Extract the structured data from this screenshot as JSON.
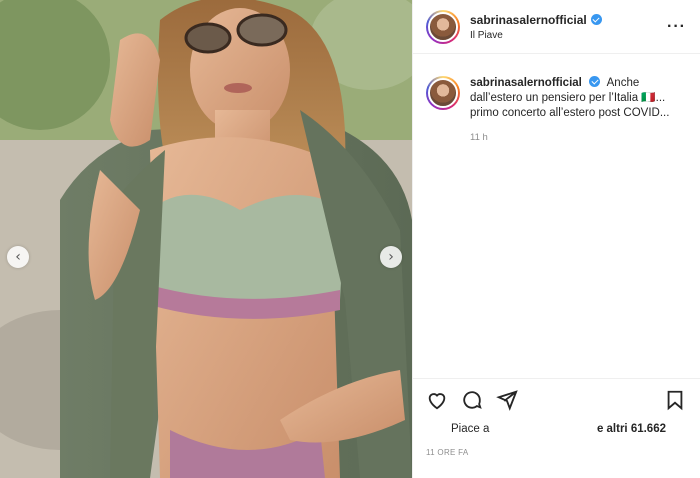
{
  "header": {
    "username": "sabrinasalernofficial",
    "location": "Il Piave",
    "more_icon": "more-horizontal-icon"
  },
  "caption": {
    "username": "sabrinasalernofficial",
    "text": "Anche dall’estero un pensiero per l’Italia 🇮🇹... primo concerto all’estero post COVID...",
    "time": "11 h"
  },
  "media": {
    "prev_icon": "chevron-left-icon",
    "next_icon": "chevron-right-icon"
  },
  "actions": {
    "like_icon": "heart-icon",
    "comment_icon": "comment-icon",
    "share_icon": "send-icon",
    "save_icon": "bookmark-icon"
  },
  "likes": {
    "liked_by": "Piace a",
    "others_label": "e altri 61.662"
  },
  "post_time": "11 ORE FA",
  "colors": {
    "verified": "#3897f0",
    "text": "#262626",
    "muted": "#8e8e8e",
    "border": "#efefef"
  }
}
